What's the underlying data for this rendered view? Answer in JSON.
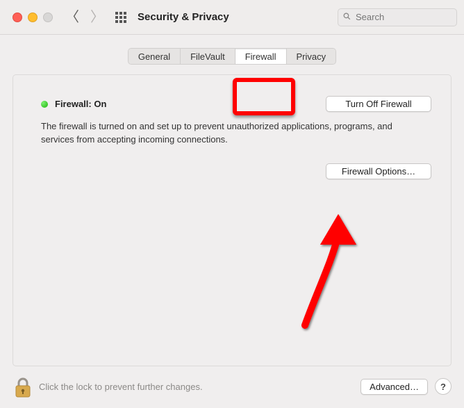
{
  "window": {
    "title": "Security & Privacy"
  },
  "search": {
    "placeholder": "Search",
    "value": ""
  },
  "tabs": {
    "general": "General",
    "filevault": "FileVault",
    "firewall": "Firewall",
    "privacy": "Privacy"
  },
  "firewall": {
    "status_label": "Firewall: On",
    "toggle_label": "Turn Off Firewall",
    "description": "The firewall is turned on and set up to prevent unauthorized applications, programs, and services from accepting incoming connections.",
    "options_label": "Firewall Options…"
  },
  "footer": {
    "lock_text": "Click the lock to prevent further changes.",
    "advanced_label": "Advanced…",
    "help_label": "?"
  }
}
